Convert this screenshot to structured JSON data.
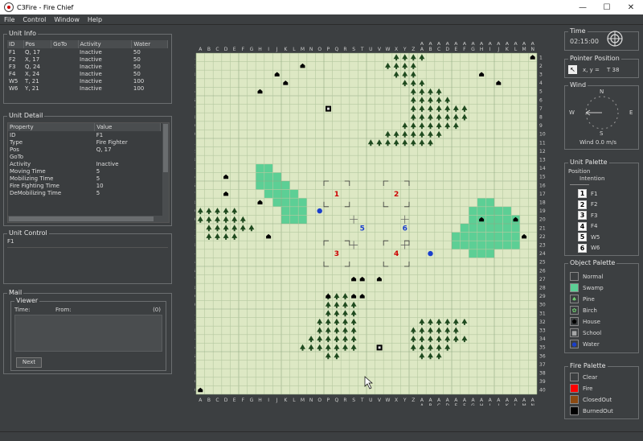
{
  "window": {
    "title": "C3Fire - Fire Chief",
    "min": "—",
    "max": "☐",
    "close": "✕"
  },
  "menu": [
    "File",
    "Control",
    "Window",
    "Help"
  ],
  "unit_info": {
    "title": "Unit Info",
    "columns": [
      "ID",
      "Pos",
      "GoTo",
      "Activity",
      "Water"
    ],
    "rows": [
      [
        "F1",
        "Q, 17",
        "",
        "Inactive",
        "50"
      ],
      [
        "F2",
        "X, 17",
        "",
        "Inactive",
        "50"
      ],
      [
        "F3",
        "Q, 24",
        "",
        "Inactive",
        "50"
      ],
      [
        "F4",
        "X, 24",
        "",
        "Inactive",
        "50"
      ],
      [
        "W5",
        "T, 21",
        "",
        "Inactive",
        "100"
      ],
      [
        "W6",
        "Y, 21",
        "",
        "Inactive",
        "100"
      ]
    ]
  },
  "unit_detail": {
    "title": "Unit Detail",
    "columns": [
      "Property",
      "Value"
    ],
    "rows": [
      [
        "ID",
        "F1"
      ],
      [
        "Type",
        "Fire Fighter"
      ],
      [
        "Pos",
        "Q, 17"
      ],
      [
        "GoTo",
        ""
      ],
      [
        "Activity",
        "Inactive"
      ],
      [
        "Moving Time",
        "5"
      ],
      [
        "Mobilizing Time",
        "5"
      ],
      [
        "Fire Fighting Time",
        "10"
      ],
      [
        "DeMobilizing Time",
        "5"
      ]
    ]
  },
  "unit_control": {
    "title": "Unit Control",
    "value": "F1"
  },
  "mail": {
    "title": "Mail",
    "viewer_title": "Viewer",
    "time_label": "Time:",
    "from_label": "From:",
    "count": "(0)",
    "next_label": "Next"
  },
  "time": {
    "title": "Time",
    "value": "02:15:00"
  },
  "pointer": {
    "title": "Pointer Position",
    "label": "x, y =",
    "value": "T 38"
  },
  "wind": {
    "title": "Wind",
    "n": "N",
    "s": "S",
    "e": "E",
    "w": "W",
    "value": "Wind 0.0 m/s"
  },
  "unit_palette": {
    "title": "Unit Palette",
    "col1": "Position",
    "col2": "Intention",
    "items": [
      {
        "n": "1",
        "label": "F1"
      },
      {
        "n": "2",
        "label": "F2"
      },
      {
        "n": "3",
        "label": "F3"
      },
      {
        "n": "4",
        "label": "F4"
      },
      {
        "n": "5",
        "label": "W5"
      },
      {
        "n": "6",
        "label": "W6"
      }
    ]
  },
  "object_palette": {
    "title": "Object Palette",
    "items": [
      {
        "label": "Normal",
        "color": "#3c3f41",
        "icon": "normal"
      },
      {
        "label": "Swamp",
        "color": "#5ccf95",
        "icon": "swamp"
      },
      {
        "label": "Pine",
        "color": "#3c3f41",
        "icon": "pine-icon"
      },
      {
        "label": "Birch",
        "color": "#3c3f41",
        "icon": "birch-icon"
      },
      {
        "label": "House",
        "color": "#3c3f41",
        "icon": "house-icon"
      },
      {
        "label": "School",
        "color": "#3c3f41",
        "icon": "school-icon"
      },
      {
        "label": "Water",
        "color": "#3c3f41",
        "icon": "water-icon"
      }
    ]
  },
  "fire_palette": {
    "title": "Fire Palette",
    "items": [
      {
        "label": "Clear",
        "color": "#3c3f41"
      },
      {
        "label": "Fire",
        "color": "#ff0000"
      },
      {
        "label": "ClosedOut",
        "color": "#8b4a12"
      },
      {
        "label": "BurnedOut",
        "color": "#000000"
      }
    ]
  },
  "map": {
    "cols": [
      "A",
      "B",
      "C",
      "D",
      "E",
      "F",
      "G",
      "H",
      "I",
      "J",
      "K",
      "L",
      "M",
      "N",
      "O",
      "P",
      "Q",
      "R",
      "S",
      "T",
      "U",
      "V",
      "W",
      "X",
      "Y",
      "Z",
      "A",
      "A",
      "A",
      "A",
      "A",
      "A",
      "A",
      "A",
      "A",
      "A",
      "A",
      "A",
      "A",
      "A"
    ],
    "cols2": [
      "",
      "",
      "",
      "",
      "",
      "",
      "",
      "",
      "",
      "",
      "",
      "",
      "",
      "",
      "",
      "",
      "",
      "",
      "",
      "",
      "",
      "",
      "",
      "",
      "",
      "",
      "A",
      "B",
      "C",
      "D",
      "E",
      "F",
      "G",
      "H",
      "I",
      "J",
      "K",
      "L",
      "M",
      "N"
    ],
    "rows": [
      "1",
      "2",
      "3",
      "4",
      "5",
      "6",
      "7",
      "8",
      "9",
      "10",
      "11",
      "12",
      "13",
      "14",
      "15",
      "16",
      "17",
      "18",
      "19",
      "20",
      "21",
      "22",
      "23",
      "24",
      "25",
      "26",
      "27",
      "28",
      "29",
      "30",
      "31",
      "32",
      "33",
      "34",
      "35",
      "36",
      "37",
      "38",
      "39",
      "40"
    ],
    "ground_color": "#dde8c4",
    "grid_color": "#b5c8a0",
    "swamp_color": "#5ccf95",
    "tree_color": "#1f4a1f",
    "house_color": "#000000",
    "units": [
      {
        "id": "1",
        "col": "Q",
        "row": "17",
        "color": "#cc0000"
      },
      {
        "id": "2",
        "col": "X",
        "row": "17",
        "color": "#cc0000"
      },
      {
        "id": "3",
        "col": "Q",
        "row": "24",
        "color": "#cc0000"
      },
      {
        "id": "4",
        "col": "X",
        "row": "24",
        "color": "#cc0000"
      },
      {
        "id": "5",
        "col": "T",
        "row": "21",
        "color": "#1a3fcc"
      },
      {
        "id": "6",
        "col": "Y",
        "row": "21",
        "color": "#1a3fcc"
      }
    ]
  }
}
